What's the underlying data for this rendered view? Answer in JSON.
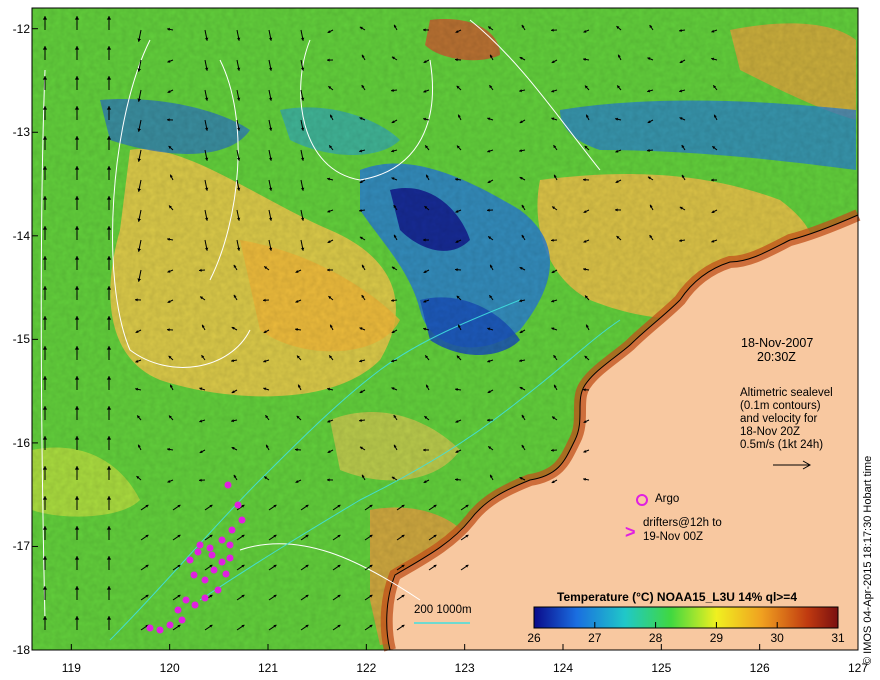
{
  "map": {
    "lat_ticks": [
      "-12",
      "-13",
      "-14",
      "-15",
      "-16",
      "-17",
      "-18"
    ],
    "lon_ticks": [
      "119",
      "120",
      "121",
      "122",
      "123",
      "124",
      "125",
      "126",
      "127"
    ],
    "lat_range": [
      -18,
      -11.8
    ],
    "lon_range": [
      118.6,
      127
    ],
    "colors": {
      "ocean_warm": "#e8c64a",
      "ocean_mid": "#5ccd3a",
      "ocean_cool": "#1d8fd6",
      "ocean_cold": "#101a90",
      "land": "#f8c8a0",
      "coast_hot": "#b83a10"
    }
  },
  "annotations": {
    "date": "18-Nov-2007",
    "time": "20:30Z",
    "altimetry_lines": [
      "Altimetric sealevel",
      "(0.1m contours)",
      "and velocity for",
      "18-Nov 20Z",
      "0.5m/s (1kt 24h)"
    ],
    "argo_label": "Argo",
    "drifters_line1": "drifters@12h to",
    "drifters_line2": "19-Nov 00Z",
    "bathy_label": "200  1000m",
    "credit": "© IMOS 04-Apr-2015 18:17:30 Hobart time"
  },
  "colorbar": {
    "title": "Temperature (°C) NOAA15_L3U 14% ql>=4",
    "ticks": [
      "26",
      "27",
      "28",
      "29",
      "30",
      "31"
    ],
    "colors": [
      "#0a0a8a",
      "#1a6ee0",
      "#20c8c8",
      "#40d840",
      "#f0f020",
      "#f0a020",
      "#c03a10",
      "#7a1010"
    ]
  }
}
